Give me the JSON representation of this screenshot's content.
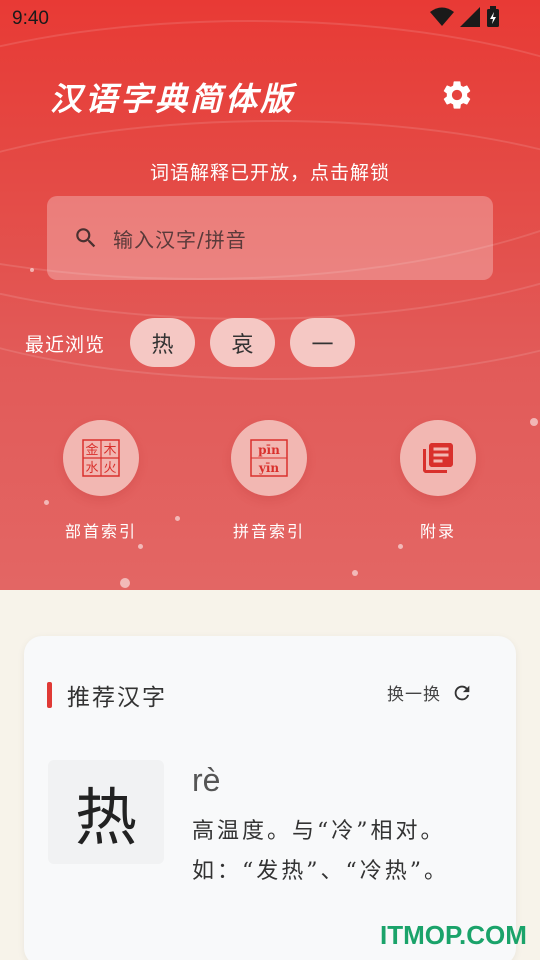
{
  "status_bar": {
    "time": "9:40"
  },
  "header": {
    "title": "汉语字典简体版"
  },
  "unlock_notice": "词语解释已开放，点击解锁",
  "search": {
    "placeholder": "输入汉字/拼音"
  },
  "recent": {
    "label": "最近浏览",
    "chips": [
      "热",
      "哀",
      "一"
    ]
  },
  "quick_links": [
    {
      "label": "部首索引",
      "icon": "radical-index-icon",
      "glyphs": [
        "金",
        "木",
        "水",
        "火"
      ]
    },
    {
      "label": "拼音索引",
      "icon": "pinyin-index-icon",
      "glyphs": [
        "pīn",
        "yīn"
      ]
    },
    {
      "label": "附录",
      "icon": "appendix-icon"
    }
  ],
  "recommend": {
    "title": "推荐汉字",
    "refresh_label": "换一换",
    "character": "热",
    "pinyin": "rè",
    "definition": "高温度。与“冷”相对。如：“发热”、“冷热”。"
  },
  "watermark": "ITMOP.COM",
  "colors": {
    "accent": "#e83a35",
    "card_bg": "#f8f9fa",
    "page_bg": "#f7f3ea"
  }
}
